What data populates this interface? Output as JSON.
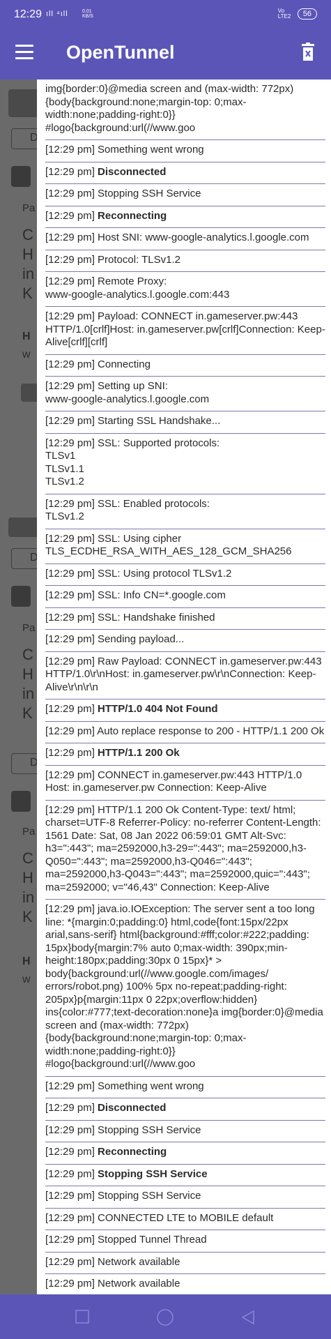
{
  "status_bar": {
    "time": "12:29",
    "signal_icons": "ıll ⁴ıll",
    "speed": "0.01 KB/S",
    "network": "Vo LTE2",
    "battery": "56"
  },
  "app_bar": {
    "title": "OpenTunnel",
    "menu_icon": "menu-icon",
    "clear_icon": "trash-icon"
  },
  "log": [
    {
      "text": "img{border:0}@media screen and (max-width: 772px){body{background:none;margin-top: 0;max-width:none;padding-right:0}} #logo{background:url(//www.goo",
      "bold": ""
    },
    {
      "text": "[12:29 pm] Something went wrong",
      "bold": ""
    },
    {
      "text": "[12:29 pm] ",
      "bold": "Disconnected"
    },
    {
      "text": "[12:29 pm] Stopping SSH Service",
      "bold": ""
    },
    {
      "text": "[12:29 pm] ",
      "bold": "Reconnecting"
    },
    {
      "text": "[12:29 pm] Host SNI: www-google-analytics.l.google.com",
      "bold": ""
    },
    {
      "text": "[12:29 pm] Protocol: TLSv1.2",
      "bold": ""
    },
    {
      "text": "[12:29 pm] Remote Proxy:\nwww-google-analytics.l.google.com:443",
      "bold": ""
    },
    {
      "text": "[12:29 pm] Payload: CONNECT in.gameserver.pw:443 HTTP/1.0[crlf]Host: in.gameserver.pw[crlf]Connection: Keep-Alive[crlf][crlf]",
      "bold": ""
    },
    {
      "text": "[12:29 pm] Connecting",
      "bold": ""
    },
    {
      "text": "[12:29 pm] Setting up SNI:\nwww-google-analytics.l.google.com",
      "bold": ""
    },
    {
      "text": "[12:29 pm] Starting SSL Handshake...",
      "bold": ""
    },
    {
      "text": "[12:29 pm] SSL: Supported protocols:\nTLSv1\nTLSv1.1\nTLSv1.2",
      "bold": ""
    },
    {
      "text": "[12:29 pm] SSL: Enabled protocols:\nTLSv1.2",
      "bold": ""
    },
    {
      "text": "[12:29 pm] SSL: Using cipher\nTLS_ECDHE_RSA_WITH_AES_128_GCM_SHA256",
      "bold": ""
    },
    {
      "text": "[12:29 pm] SSL: Using protocol TLSv1.2",
      "bold": ""
    },
    {
      "text": "[12:29 pm] SSL: Info CN=*.google.com",
      "bold": ""
    },
    {
      "text": "[12:29 pm] SSL: Handshake finished",
      "bold": ""
    },
    {
      "text": "[12:29 pm] Sending payload...",
      "bold": ""
    },
    {
      "text": "[12:29 pm] Raw Payload: CONNECT in.gameserver.pw:443 HTTP/1.0\\r\\nHost: in.gameserver.pw\\r\\nConnection: Keep-Alive\\r\\n\\r\\n",
      "bold": ""
    },
    {
      "text": "[12:29 pm] ",
      "bold": "HTTP/1.0 404 Not Found"
    },
    {
      "text": "[12:29 pm] Auto replace response to 200 - HTTP/1.1 200 Ok",
      "bold": ""
    },
    {
      "text": "[12:29 pm] ",
      "bold": "HTTP/1.1 200 Ok"
    },
    {
      "text": "[12:29 pm] CONNECT in.gameserver.pw:443 HTTP/1.0 Host: in.gameserver.pw Connection: Keep-Alive",
      "bold": ""
    },
    {
      "text": "[12:29 pm] HTTP/1.1 200 Ok Content-Type: text/ html; charset=UTF-8 Referrer-Policy: no-referrer Content-Length: 1561 Date: Sat, 08 Jan 2022 06:59:01 GMT Alt-Svc: h3=\":443\"; ma=2592000,h3-29=\":443\"; ma=2592000,h3-Q050=\":443\"; ma=2592000,h3-Q046=\":443\"; ma=2592000,h3-Q043=\":443\"; ma=2592000,quic=\":443\"; ma=2592000; v=\"46,43\" Connection: Keep-Alive",
      "bold": ""
    },
    {
      "text": "[12:29 pm] java.io.IOException: The server sent a too long line: *{margin:0;padding:0} html,code{font:15px/22px arial,sans-serif} html{background:#fff;color:#222;padding: 15px}body{margin:7% auto 0;max-width: 390px;min-height:180px;padding:30px 0 15px}* > body{background:url(//www.google.com/images/ errors/robot.png) 100% 5px no-repeat;padding-right: 205px}p{margin:11px 0 22px;overflow:hidden} ins{color:#777;text-decoration:none}a img{border:0}@media screen and (max-width: 772px){body{background:none;margin-top: 0;max-width:none;padding-right:0}} #logo{background:url(//www.goo",
      "bold": ""
    },
    {
      "text": "[12:29 pm] Something went wrong",
      "bold": ""
    },
    {
      "text": "[12:29 pm] ",
      "bold": "Disconnected"
    },
    {
      "text": "[12:29 pm] Stopping SSH Service",
      "bold": ""
    },
    {
      "text": "[12:29 pm] ",
      "bold": "Reconnecting"
    },
    {
      "text": "[12:29 pm] ",
      "bold": "Stopping SSH Service"
    },
    {
      "text": "[12:29 pm] Stopping SSH Service",
      "bold": ""
    },
    {
      "text": "[12:29 pm] CONNECTED LTE to MOBILE default",
      "bold": ""
    },
    {
      "text": "[12:29 pm] Stopped Tunnel Thread",
      "bold": ""
    },
    {
      "text": "[12:29 pm] Network available",
      "bold": ""
    },
    {
      "text": "[12:29 pm] Network available",
      "bold": ""
    }
  ],
  "background_app": {
    "labels": [
      "D",
      "Pa",
      "C",
      "H",
      "in",
      "K",
      "H",
      "w",
      "D",
      "Pa",
      "C",
      "H",
      "in",
      "K",
      "D",
      "Pa",
      "C",
      "H",
      "in",
      "K",
      "H",
      "w"
    ]
  },
  "nav_bar": {
    "recent_icon": "square-icon",
    "home_icon": "circle-icon",
    "back_icon": "triangle-back-icon"
  }
}
